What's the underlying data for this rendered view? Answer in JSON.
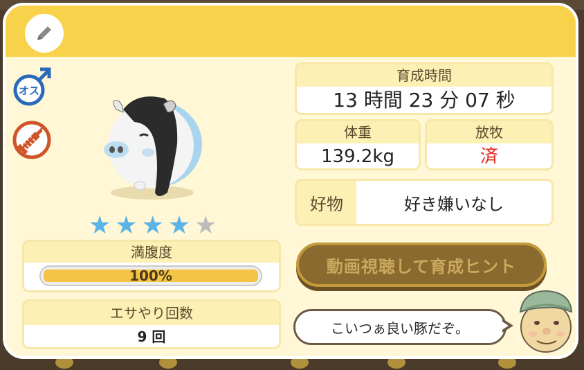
{
  "gender": {
    "label": "オス",
    "color": "#2a6ab8"
  },
  "vaccine": {
    "color": "#d0542a"
  },
  "rating": {
    "value": 4,
    "max": 5,
    "on_color": "#5cb4e6",
    "off_color": "#bdbdbd"
  },
  "fullness": {
    "label": "満腹度",
    "value_text": "100%",
    "value": 1.0
  },
  "feed": {
    "label": "エサやり回数",
    "value": "9 回"
  },
  "growth": {
    "label": "育成時間",
    "value": "13 時間 23 分 07 秒"
  },
  "weight": {
    "label": "体重",
    "value": "139.2kg"
  },
  "grazing": {
    "label": "放牧",
    "value": "済",
    "value_color": "#e0281e"
  },
  "preference": {
    "label": "好物",
    "value": "好き嫌いなし"
  },
  "hint_button": {
    "label": "動画視聴して育成ヒント"
  },
  "npc": {
    "speech": "こいつぁ良い豚だぞ。"
  },
  "colors": {
    "header": "#f8d24b",
    "panel": "#fff7d6",
    "label_bg": "#fdf0b4"
  },
  "icons": [
    "pencil-icon",
    "male-icon",
    "syringe-icon",
    "pig-character",
    "farmer-avatar",
    "star-icon"
  ]
}
